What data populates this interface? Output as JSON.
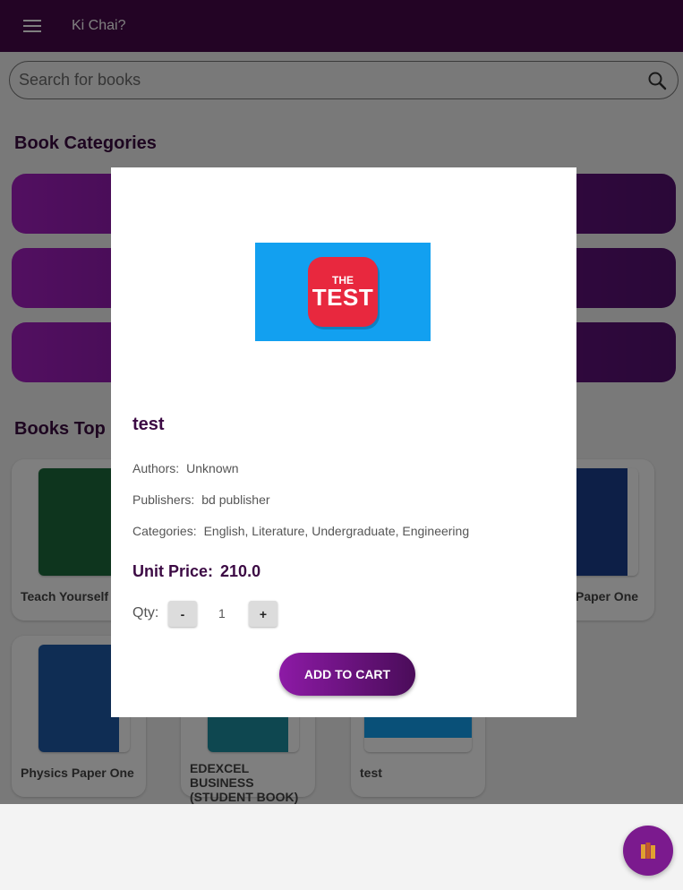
{
  "app": {
    "title": "Ki Chai?"
  },
  "search": {
    "placeholder": "Search for books"
  },
  "sections": {
    "categories_title": "Book Categories",
    "top_title": "Books Top C"
  },
  "books": [
    {
      "title": "Teach Yourself C"
    },
    {
      "title": "Paper One"
    },
    {
      "title": "Physics Paper One"
    },
    {
      "title": "EDEXCEL BUSINESS (STUDENT BOOK)"
    },
    {
      "title": "test"
    }
  ],
  "dialog": {
    "title": "test",
    "authors_label": "Authors:",
    "authors": "Unknown",
    "publishers_label": "Publishers:",
    "publishers": "bd publisher",
    "categories_label": "Categories:",
    "categories": "English, Literature, Undergraduate, Engineering",
    "price_label": "Unit Price:",
    "price": "210.0",
    "qty_label": "Qty:",
    "minus": "-",
    "qty": "1",
    "plus": "+",
    "add_to_cart": "ADD TO CART",
    "image_logo_top": "THE",
    "image_logo_bottom": "TEST"
  },
  "icons": {
    "menu": "menu-icon",
    "search": "search-icon",
    "fab": "books-icon"
  },
  "colors": {
    "appbar": "#46084a",
    "accent": "#7b1a8e",
    "title": "#3c0a44"
  }
}
